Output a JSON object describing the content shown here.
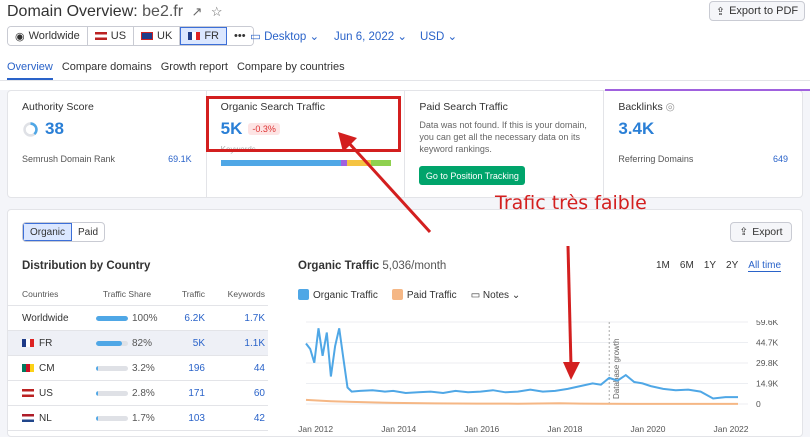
{
  "header": {
    "title": "Domain Overview:",
    "domain": "be2.fr",
    "export_pdf": "Export to PDF"
  },
  "db_tabs": [
    {
      "label": "Worldwide",
      "icon": "globe-icon"
    },
    {
      "label": "US",
      "icon": "us-flag-icon"
    },
    {
      "label": "UK",
      "icon": "uk-flag-icon"
    },
    {
      "label": "FR",
      "icon": "fr-flag-icon",
      "active": true
    }
  ],
  "selectors": {
    "device": "Desktop",
    "date": "Jun 6, 2022",
    "currency": "USD"
  },
  "nav_tabs": [
    "Overview",
    "Compare domains",
    "Growth report",
    "Compare by countries"
  ],
  "cards": {
    "authority": {
      "title": "Authority Score",
      "value": "38",
      "sub_label": "Semrush Domain Rank",
      "sub_value": "69.1K"
    },
    "organic": {
      "title": "Organic Search Traffic",
      "value": "5K",
      "change": "-0.3%",
      "keywords_label": "Keywords"
    },
    "paid": {
      "title": "Paid Search Traffic",
      "message": "Data was not found. If this is your domain, you can get all the necessary data on its keyword rankings.",
      "button": "Go to Position Tracking"
    },
    "backlinks": {
      "title": "Backlinks",
      "value": "3.4K",
      "sub_label": "Referring Domains",
      "sub_value": "649"
    }
  },
  "panel": {
    "toggle": [
      "Organic",
      "Paid"
    ],
    "export": "Export",
    "distribution_title": "Distribution by Country",
    "columns": [
      "Countries",
      "Traffic Share",
      "Traffic",
      "Keywords"
    ],
    "rows": [
      {
        "country": "Worldwide",
        "share": "100%",
        "share_frac": 1.0,
        "traffic": "6.2K",
        "keywords": "1.7K",
        "icon": "globe-icon"
      },
      {
        "country": "FR",
        "share": "82%",
        "share_frac": 0.82,
        "traffic": "5K",
        "keywords": "1.1K",
        "icon": "fr-flag-icon",
        "highlight": true
      },
      {
        "country": "CM",
        "share": "3.2%",
        "share_frac": 0.032,
        "traffic": "196",
        "keywords": "44",
        "icon": "cm-flag-icon"
      },
      {
        "country": "US",
        "share": "2.8%",
        "share_frac": 0.028,
        "traffic": "171",
        "keywords": "60",
        "icon": "us-flag-icon"
      },
      {
        "country": "NL",
        "share": "1.7%",
        "share_frac": 0.017,
        "traffic": "103",
        "keywords": "42",
        "icon": "nl-flag-icon"
      }
    ],
    "organic_traffic_title": "Organic Traffic",
    "organic_traffic_value": "5,036/month",
    "ranges": [
      "1M",
      "6M",
      "1Y",
      "2Y",
      "All time"
    ],
    "legend": {
      "organic": "Organic Traffic",
      "paid": "Paid Traffic",
      "notes": "Notes"
    }
  },
  "annotation": "Trafic très faible",
  "chart_data": {
    "type": "line",
    "x_ticks": [
      "Jan 2012",
      "Jan 2014",
      "Jan 2016",
      "Jan 2018",
      "Jan 2020",
      "Jan 2022"
    ],
    "y_ticks": [
      "59.6K",
      "44.7K",
      "29.8K",
      "14.9K",
      "0"
    ],
    "ylim": [
      0,
      59600
    ],
    "annotation_line": "Database growth",
    "series": [
      {
        "name": "Organic Traffic",
        "color": "#4fa7e6",
        "x": [
          2011.9,
          2012.0,
          2012.1,
          2012.2,
          2012.3,
          2012.4,
          2012.5,
          2012.6,
          2012.7,
          2012.8,
          2012.9,
          2013.0,
          2013.2,
          2013.5,
          2013.8,
          2014.0,
          2014.3,
          2014.6,
          2014.9,
          2015.2,
          2015.5,
          2015.8,
          2016.1,
          2016.4,
          2016.7,
          2017.0,
          2017.3,
          2017.6,
          2017.9,
          2018.2,
          2018.5,
          2018.8,
          2019.0,
          2019.2,
          2019.4,
          2019.6,
          2019.8,
          2020.0,
          2020.2,
          2020.5,
          2020.8,
          2021.1,
          2021.4,
          2021.7,
          2022.0,
          2022.3
        ],
        "values": [
          44000,
          40000,
          30000,
          55000,
          35000,
          52000,
          20000,
          42000,
          55000,
          33000,
          12000,
          9000,
          9500,
          10000,
          9000,
          9500,
          8000,
          8500,
          9000,
          8000,
          9500,
          8500,
          9000,
          10000,
          8500,
          9000,
          10500,
          9000,
          9500,
          11000,
          13000,
          15000,
          14000,
          19000,
          17000,
          21000,
          16000,
          15000,
          13000,
          11000,
          10000,
          10500,
          9000,
          4000,
          5000,
          5036
        ]
      },
      {
        "name": "Paid Traffic",
        "color": "#f5b785",
        "x": [
          2011.9,
          2012.5,
          2013.0,
          2014.0,
          2015.0,
          2016.0,
          2017.0,
          2018.0,
          2018.5,
          2019.0,
          2020.0,
          2021.0,
          2022.3
        ],
        "values": [
          3000,
          2000,
          1500,
          800,
          400,
          300,
          200,
          500,
          300,
          200,
          100,
          100,
          100
        ]
      }
    ]
  }
}
